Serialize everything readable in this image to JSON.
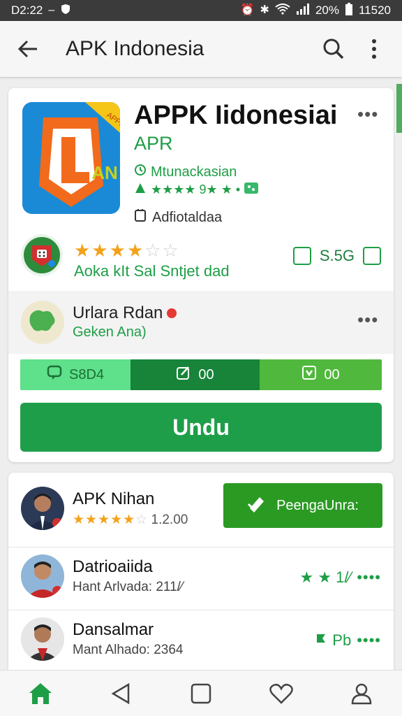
{
  "status_bar": {
    "time": "D2:22",
    "battery": "20%",
    "clock_right": "11520"
  },
  "app_bar": {
    "title": "APK Indonesia"
  },
  "app": {
    "name": "APPK Iidonesiai",
    "developer": "APR",
    "meta_line1": "Mtunackasian",
    "meta_line2": "★★★★ 9★ ★ •",
    "meta_line3": "Adfiotaldaa",
    "icon_badge": "APPK",
    "icon_letters": "AN"
  },
  "rating_row": {
    "stars_filled": 3.5,
    "stars_total": 6,
    "caption": "Aoka kIt  Sal Sntjet dad",
    "size": "S.5G"
  },
  "owner_row": {
    "title": "Urlara Rdan",
    "subtitle": "Geken Ana)"
  },
  "stats": {
    "seg1": "S8D4",
    "seg2": "00",
    "seg3": "00"
  },
  "download": {
    "label": "Undu"
  },
  "people": [
    {
      "name": "APK Nihan",
      "rating_value": "1.2.00",
      "stars_filled": 5,
      "action_label": "PeengaUnra:"
    },
    {
      "name": "Datrioaiida",
      "sub": "Hant Arlvada: 211/⁄",
      "right": "★ ★ 1/⁄"
    },
    {
      "name": "Dansalmar",
      "sub": "Mant Alhado: 2364",
      "right": "Pb"
    }
  ],
  "colors": {
    "accent_green": "#1f9e4a",
    "status_bar": "#3b3b3b",
    "star": "#f4a21b"
  },
  "icons": {
    "nav": [
      "home-icon",
      "back-icon",
      "recents-icon",
      "heart-icon",
      "profile-icon"
    ]
  }
}
